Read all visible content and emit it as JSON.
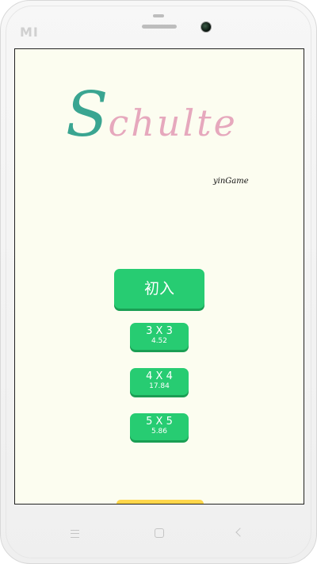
{
  "device": {
    "brand_logo": "MI"
  },
  "app": {
    "title_initial": "S",
    "title_rest": "chulte",
    "subtitle": "yinGame",
    "colors": {
      "background": "#fcfdf0",
      "title_initial": "#3aa591",
      "title_rest": "#e6a8bd",
      "button": "#27cc72",
      "button_shadow": "#1a9e54",
      "bottom_strip": "#ffd64a"
    }
  },
  "menu": {
    "main_button_label": "初入",
    "levels": [
      {
        "label": "3 X 3",
        "score": "4.52"
      },
      {
        "label": "4 X 4",
        "score": "17.84"
      },
      {
        "label": "5 X 5",
        "score": "5.86"
      }
    ]
  },
  "nav": {
    "menu_icon": "menu-icon",
    "home_icon": "home-icon",
    "back_icon": "back-icon"
  }
}
